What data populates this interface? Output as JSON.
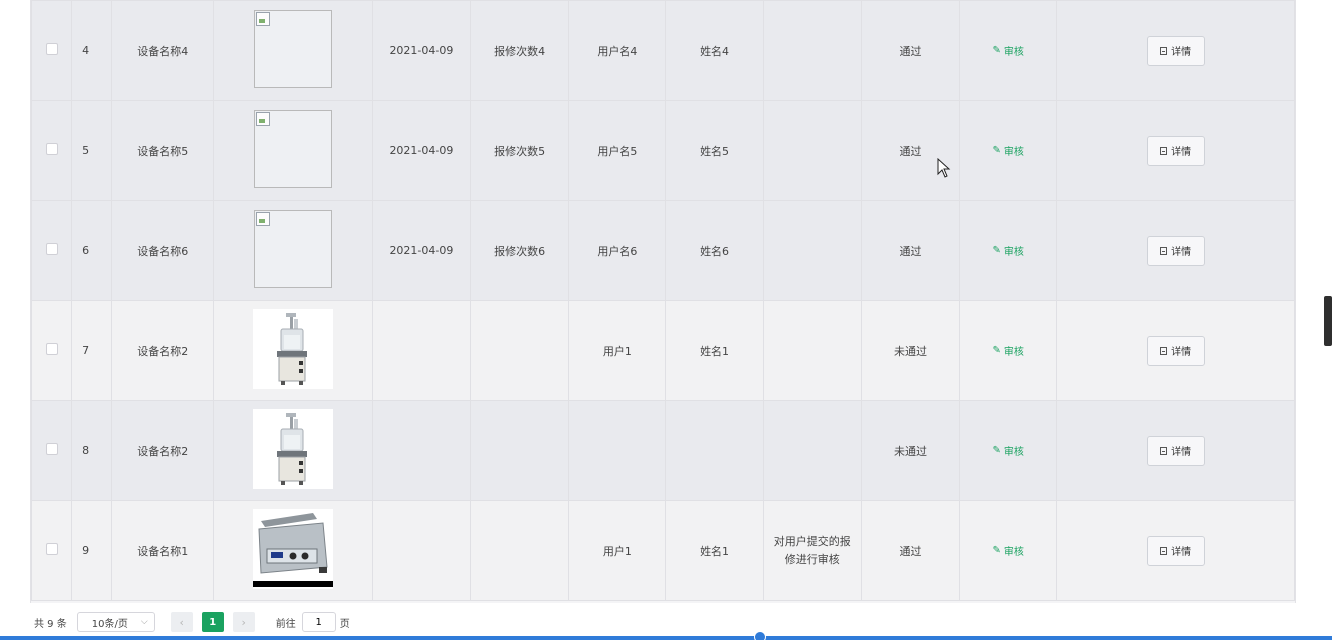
{
  "rows": [
    {
      "idx": "4",
      "name": "设备名称4",
      "image": "broken",
      "date": "2021-04-09",
      "repairs": "报修次数4",
      "user": "用户名4",
      "realname": "姓名4",
      "remark": "",
      "status": "通过",
      "audit": "审核",
      "detail": "详情"
    },
    {
      "idx": "5",
      "name": "设备名称5",
      "image": "broken",
      "date": "2021-04-09",
      "repairs": "报修次数5",
      "user": "用户名5",
      "realname": "姓名5",
      "remark": "",
      "status": "通过",
      "audit": "审核",
      "detail": "详情"
    },
    {
      "idx": "6",
      "name": "设备名称6",
      "image": "broken",
      "date": "2021-04-09",
      "repairs": "报修次数6",
      "user": "用户名6",
      "realname": "姓名6",
      "remark": "",
      "status": "通过",
      "audit": "审核",
      "detail": "详情"
    },
    {
      "idx": "7",
      "name": "设备名称2",
      "image": "apparatus",
      "date": "",
      "repairs": "",
      "user": "用户1",
      "realname": "姓名1",
      "remark": "",
      "status": "未通过",
      "audit": "审核",
      "detail": "详情"
    },
    {
      "idx": "8",
      "name": "设备名称2",
      "image": "apparatus",
      "date": "",
      "repairs": "",
      "user": "",
      "realname": "",
      "remark": "",
      "status": "未通过",
      "audit": "审核",
      "detail": "详情"
    },
    {
      "idx": "9",
      "name": "设备名称1",
      "image": "ultrasonic-cleaner",
      "date": "",
      "repairs": "",
      "user": "用户1",
      "realname": "姓名1",
      "remark": "对用户提交的报修进行审核",
      "status": "通过",
      "audit": "审核",
      "detail": "详情"
    }
  ],
  "pagination": {
    "total": "共 9 条",
    "page_size": "10条/页",
    "prev": "‹",
    "current": "1",
    "next": "›",
    "goto_label": "前往",
    "goto_value": "1",
    "page_suffix": "页"
  },
  "colors": {
    "accent": "#1aa260",
    "row_a": "#e9eaee",
    "row_b": "#f2f2f3",
    "bar": "#2f7bd9"
  }
}
